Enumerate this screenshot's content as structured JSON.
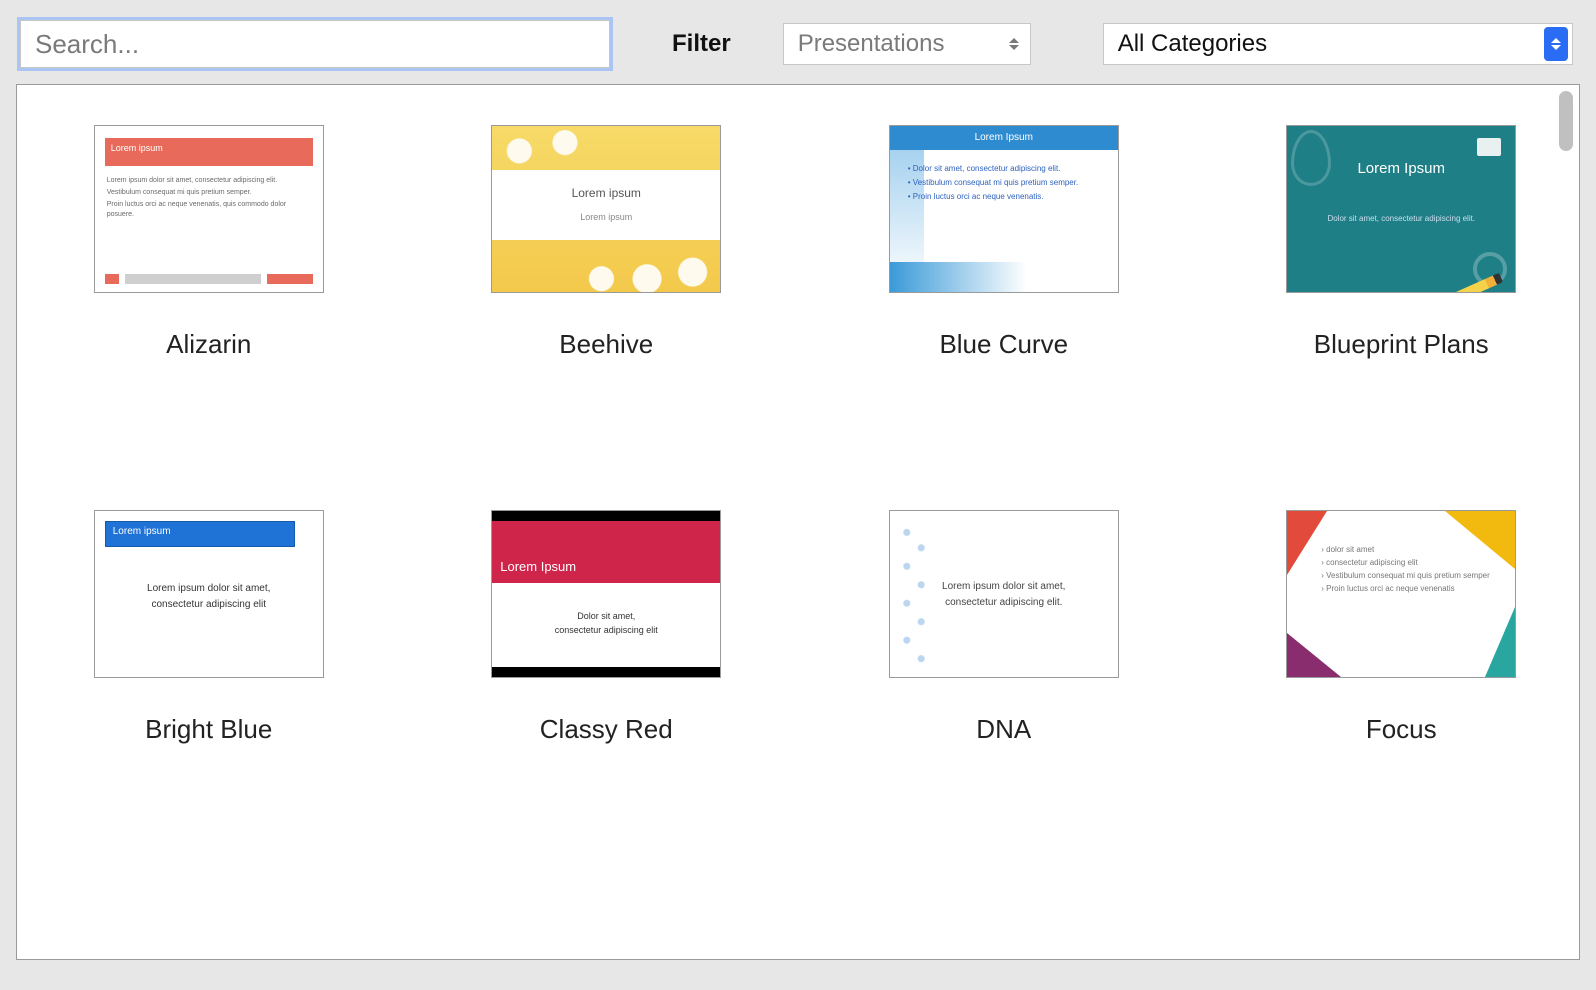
{
  "search": {
    "placeholder": "Search..."
  },
  "filter_label": "Filter",
  "type_select": {
    "value": "Presentations"
  },
  "category_select": {
    "value": "All Categories"
  },
  "templates": [
    {
      "name": "Alizarin"
    },
    {
      "name": "Beehive"
    },
    {
      "name": "Blue Curve"
    },
    {
      "name": "Blueprint Plans"
    },
    {
      "name": "Bright Blue"
    },
    {
      "name": "Classy Red"
    },
    {
      "name": "DNA"
    },
    {
      "name": "Focus"
    }
  ],
  "thumb_text": {
    "lorem_title": "Lorem Ipsum",
    "lorem_title_lc": "Lorem ipsum",
    "lorem_sub_lc": "Lorem ipsum",
    "aliz_p1": "Lorem ipsum dolor sit amet, consectetur adipiscing elit.",
    "aliz_p2": "Vestibulum consequat mi quis pretium semper.",
    "aliz_p3": "Proin luctus orci ac neque venenatis, quis commodo dolor posuere.",
    "bcurve_l1": "Dolor sit amet, consectetur adipiscing elit.",
    "bcurve_l2": "Vestibulum consequat mi quis pretium semper.",
    "bcurve_l3": "Proin luctus orci ac neque venenatis.",
    "bp_sub": "Dolor sit amet, consectetur adipiscing elit.",
    "bb_c1": "Lorem ipsum dolor sit amet,",
    "bb_c2": "consectetur adipiscing elit",
    "cr_d1": "Dolor sit amet,",
    "cr_d2": "consectetur adipiscing elit",
    "dna_d1": "Lorem ipsum dolor sit amet,",
    "dna_d2": "consectetur adipiscing elit.",
    "focus_l1": "dolor sit amet",
    "focus_l2": "consectetur adipiscing elit",
    "focus_l3": "Vestibulum consequat mi quis pretium semper",
    "focus_l4": "Proin luctus orci ac neque venenatis"
  }
}
